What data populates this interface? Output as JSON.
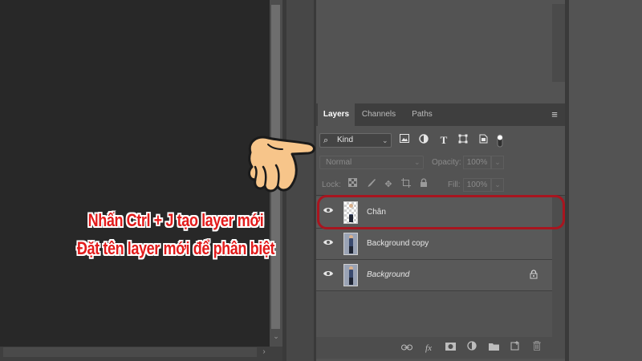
{
  "tabs": {
    "layers": "Layers",
    "channels": "Channels",
    "paths": "Paths"
  },
  "filter": {
    "kind_label": "Kind"
  },
  "blend": {
    "mode": "Normal",
    "opacity_label": "Opacity:",
    "opacity_value": "100%"
  },
  "lock": {
    "label": "Lock:",
    "fill_label": "Fill:",
    "fill_value": "100%"
  },
  "layers": [
    {
      "name": "Chân",
      "italic": false,
      "locked": false,
      "thumb": "transparent"
    },
    {
      "name": "Background copy",
      "italic": false,
      "locked": false,
      "thumb": "photo"
    },
    {
      "name": "Background",
      "italic": true,
      "locked": true,
      "thumb": "photo"
    }
  ],
  "annotation": {
    "line1": "Nhấn Ctrl + J tạo layer mới",
    "line2": "Đặt tên layer mới để phân biệt",
    "highlight_color": "#a8151f",
    "text_color": "#e21b1b"
  },
  "colors": {
    "panel_bg": "#535353",
    "canvas_bg": "#282828",
    "tab_bar_bg": "#3e3e3e"
  },
  "icons": {
    "filter": [
      "image-filter-icon",
      "adjustment-filter-icon",
      "type-filter-icon",
      "shape-filter-icon",
      "smart-object-filter-icon"
    ],
    "lock": [
      "lock-transparent-pixels-icon",
      "lock-image-pixels-icon",
      "lock-position-icon",
      "lock-artboard-icon",
      "lock-all-icon"
    ],
    "footer": [
      "link-layers-icon",
      "fx-icon",
      "add-mask-icon",
      "adjustment-layer-icon",
      "new-group-icon",
      "new-layer-icon",
      "delete-layer-icon"
    ]
  }
}
